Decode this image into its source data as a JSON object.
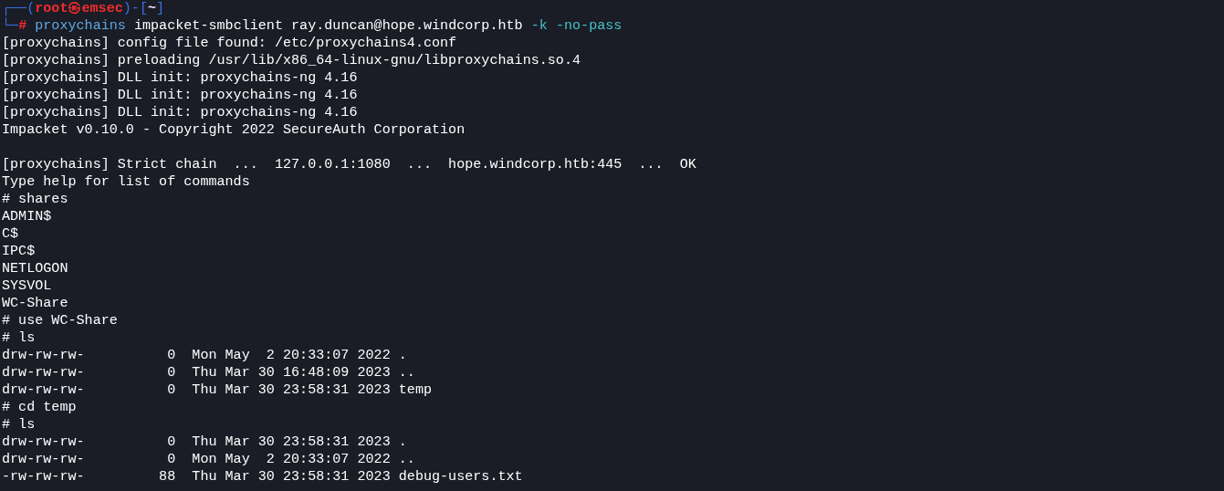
{
  "prompt": [
    [
      {
        "kind": "frame",
        "text": "┌──("
      },
      {
        "kind": "user",
        "text": "root㉿emsec"
      },
      {
        "kind": "frame",
        "text": ")-["
      },
      {
        "kind": "dir",
        "text": "~"
      },
      {
        "kind": "frame",
        "text": "]"
      }
    ],
    [
      {
        "kind": "frame",
        "text": "└─"
      },
      {
        "kind": "symbol",
        "text": "#"
      },
      {
        "kind": "program",
        "text": " proxychains"
      },
      {
        "kind": "arg",
        "text": " impacket-smbclient ray.duncan@hope.windcorp.htb "
      },
      {
        "kind": "option",
        "text": "-k -no-pass"
      }
    ]
  ],
  "output": [
    {
      "kind": "text",
      "text": "[proxychains] config file found: /etc/proxychains4.conf"
    },
    {
      "kind": "text",
      "text": "[proxychains] preloading /usr/lib/x86_64-linux-gnu/libproxychains.so.4"
    },
    {
      "kind": "text",
      "text": "[proxychains] DLL init: proxychains-ng 4.16"
    },
    {
      "kind": "text",
      "text": "[proxychains] DLL init: proxychains-ng 4.16"
    },
    {
      "kind": "text",
      "text": "[proxychains] DLL init: proxychains-ng 4.16"
    },
    {
      "kind": "text",
      "text": "Impacket v0.10.0 - Copyright 2022 SecureAuth Corporation"
    },
    {
      "kind": "blank"
    },
    {
      "kind": "text",
      "text": "[proxychains] Strict chain  ...  127.0.0.1:1080  ...  hope.windcorp.htb:445  ...  OK"
    },
    {
      "kind": "text",
      "text": "Type help for list of commands"
    },
    {
      "kind": "text",
      "text": "# shares"
    },
    {
      "kind": "text",
      "text": "ADMIN$"
    },
    {
      "kind": "text",
      "text": "C$"
    },
    {
      "kind": "text",
      "text": "IPC$"
    },
    {
      "kind": "text",
      "text": "NETLOGON"
    },
    {
      "kind": "text",
      "text": "SYSVOL"
    },
    {
      "kind": "text",
      "text": "WC-Share"
    },
    {
      "kind": "text",
      "text": "# use WC-Share"
    },
    {
      "kind": "text",
      "text": "# ls"
    },
    {
      "kind": "text",
      "text": "drw-rw-rw-          0  Mon May  2 20:33:07 2022 ."
    },
    {
      "kind": "text",
      "text": "drw-rw-rw-          0  Thu Mar 30 16:48:09 2023 .."
    },
    {
      "kind": "text",
      "text": "drw-rw-rw-          0  Thu Mar 30 23:58:31 2023 temp"
    },
    {
      "kind": "text",
      "text": "# cd temp"
    },
    {
      "kind": "text",
      "text": "# ls"
    },
    {
      "kind": "text",
      "text": "drw-rw-rw-          0  Thu Mar 30 23:58:31 2023 ."
    },
    {
      "kind": "text",
      "text": "drw-rw-rw-          0  Mon May  2 20:33:07 2022 .."
    },
    {
      "kind": "text",
      "text": "-rw-rw-rw-         88  Thu Mar 30 23:58:31 2023 debug-users.txt"
    }
  ]
}
